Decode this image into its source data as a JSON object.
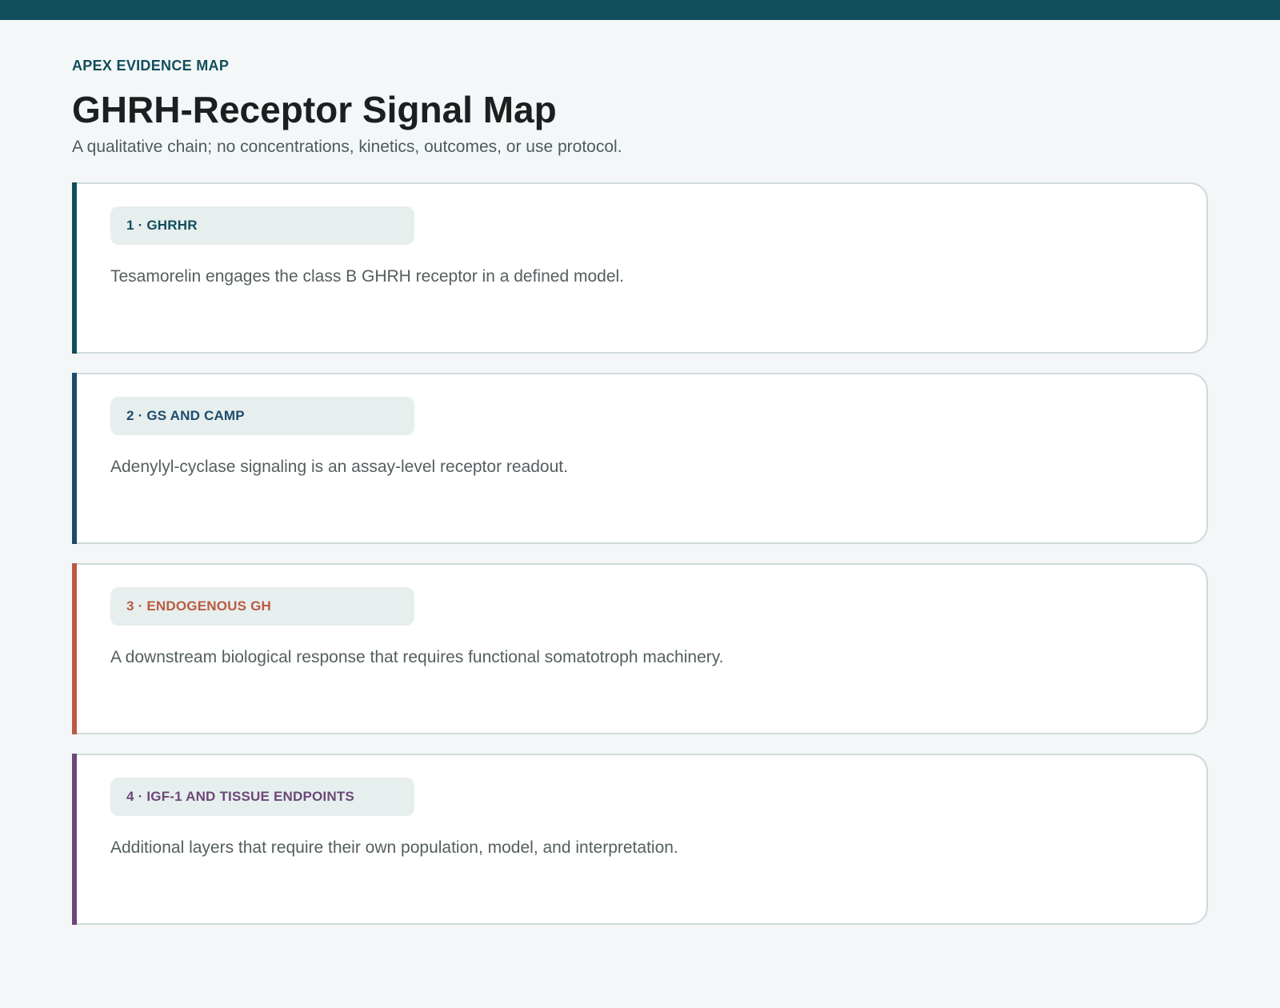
{
  "header": {
    "eyebrow": "APEX EVIDENCE MAP",
    "title": "GHRH-Receptor Signal Map",
    "subtitle": "A qualitative chain; no concentrations, kinetics, outcomes, or use protocol."
  },
  "steps": [
    {
      "label": "1 · GHRHR",
      "text": "Tesamorelin engages the class B GHRH receptor in a defined model.",
      "color": "#124d5c"
    },
    {
      "label": "2 · GS AND CAMP",
      "text": "Adenylyl-cyclase signaling is an assay-level receptor readout.",
      "color": "#1d4a6c"
    },
    {
      "label": "3 · ENDOGENOUS GH",
      "text": "A downstream biological response that requires functional somatotroph machinery.",
      "color": "#bb5a41"
    },
    {
      "label": "4 · IGF-1 AND TISSUE ENDPOINTS",
      "text": "Additional layers that require their own population, model, and interpretation.",
      "color": "#6c4779"
    }
  ]
}
